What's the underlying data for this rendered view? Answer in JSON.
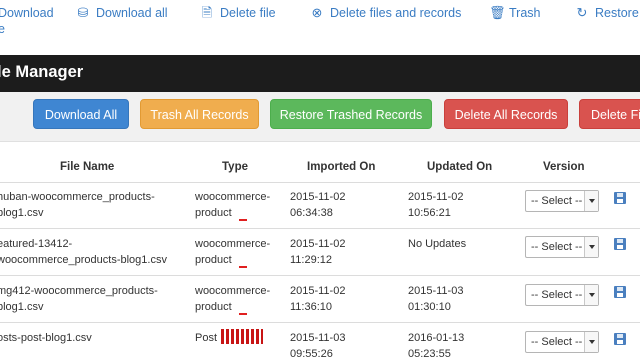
{
  "toolbar": {
    "download": "Download",
    "download_wrap": "e",
    "download_all": "Download all",
    "delete_file": "Delete file",
    "delete_files_records": "Delete files and records",
    "trash": "Trash",
    "restore": "Restore"
  },
  "title": "le Manager",
  "buttons": {
    "download_all": "Download All",
    "trash_all": "Trash All Records",
    "restore_trashed": "Restore Trashed Records",
    "delete_all": "Delete All Records",
    "delete_files": "Delete Fi"
  },
  "table": {
    "headers": [
      "File Name",
      "Type",
      "Imported On",
      "Updated On",
      "Version"
    ],
    "select_placeholder": "-- Select --",
    "rows": [
      {
        "name1": "huban-woocommerce_products-",
        "name2": "blog1.csv",
        "type1": "woocommerce-",
        "type2": "product",
        "imp1": "2015-11-02",
        "imp2": "06:34:38",
        "upd1": "2015-11-02",
        "upd2": "10:56:21"
      },
      {
        "name1": "eatured-13412-",
        "name2": "woocommerce_products-blog1.csv",
        "type1": "woocommerce-",
        "type2": "product",
        "imp1": "2015-11-02",
        "imp2": "11:29:12",
        "upd1": "No Updates",
        "upd2": ""
      },
      {
        "name1": "mg412-woocommerce_products-",
        "name2": "blog1.csv",
        "type1": "woocommerce-",
        "type2": "product",
        "imp1": "2015-11-02",
        "imp2": "11:36:10",
        "upd1": "2015-11-03",
        "upd2": "01:30:10"
      },
      {
        "name1": "osts-post-blog1.csv",
        "name2": "",
        "type1": "Post",
        "type2": "",
        "imp1": "2015-11-03",
        "imp2": "09:55:26",
        "upd1": "2016-01-13",
        "upd2": "05:23:55"
      }
    ]
  },
  "colors": {
    "link_blue": "#3a7cc3",
    "title_bg": "#1c1c1c",
    "btn_blue": "#3f86d2",
    "btn_orange": "#f0ad4e",
    "btn_green": "#5cb85c",
    "btn_red": "#d9534f"
  }
}
